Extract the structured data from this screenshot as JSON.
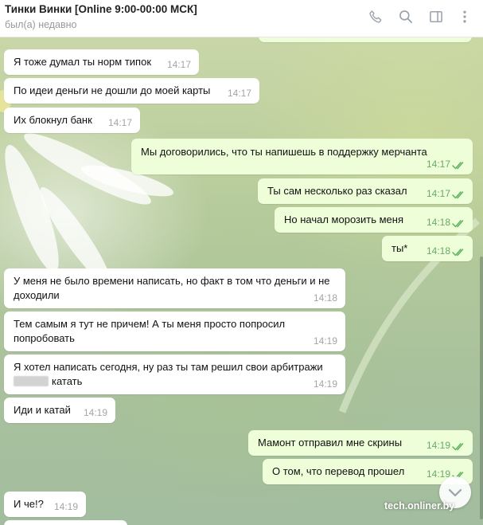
{
  "header": {
    "title": "Тинки Винки [Online 9:00-00:00 МСК]",
    "status": "был(а) недавно",
    "icons": [
      "phone-icon",
      "search-icon",
      "sidebar-toggle-icon",
      "more-vertical-icon"
    ]
  },
  "messages": [
    {
      "dir": "in",
      "text": "Я тоже думал ты норм типок",
      "time": "14:17"
    },
    {
      "dir": "in",
      "text": "По идеи деньги не дошли до моей карты",
      "time": "14:17"
    },
    {
      "dir": "in",
      "text": "Их блокнул банк",
      "time": "14:17"
    },
    {
      "dir": "out",
      "text": "Мы договорились, что  ты напишешь в поддержку мерчанта",
      "time": "14:17",
      "read": true
    },
    {
      "dir": "out",
      "text": "Ты сам несколько раз сказал",
      "time": "14:17",
      "read": true
    },
    {
      "dir": "out",
      "text": "Но начал морозить меня",
      "time": "14:18",
      "read": true
    },
    {
      "dir": "out",
      "text": "ты*",
      "time": "14:18",
      "read": true
    },
    {
      "dir": "in",
      "text": "У меня не было времени написать, но факт в том что деньги и не доходили",
      "time": "14:18"
    },
    {
      "dir": "in",
      "text": "Тем самым я тут не причем! А ты меня просто попросил попробовать",
      "time": "14:19"
    },
    {
      "dir": "in",
      "text_before": "Я хотел написать сегодня, ну раз ты там решил свои арбитражи",
      "text_after": "катать",
      "time": "14:19"
    },
    {
      "dir": "in",
      "text": "Иди и катай",
      "time": "14:19"
    },
    {
      "dir": "out",
      "text": "Мамонт отправил мне скрины",
      "time": "14:19",
      "read": true
    },
    {
      "dir": "out",
      "text": "О том, что перевод прошел",
      "time": "14:19",
      "read": true
    },
    {
      "dir": "in",
      "text": "И че!?",
      "time": "14:19"
    }
  ],
  "watermark": "tech.onliner.by",
  "colors": {
    "incoming_bubble": "#ffffff",
    "outgoing_bubble": "#eefed9",
    "outgoing_time": "#6aa96a",
    "check_marks": "#5fb35f"
  }
}
